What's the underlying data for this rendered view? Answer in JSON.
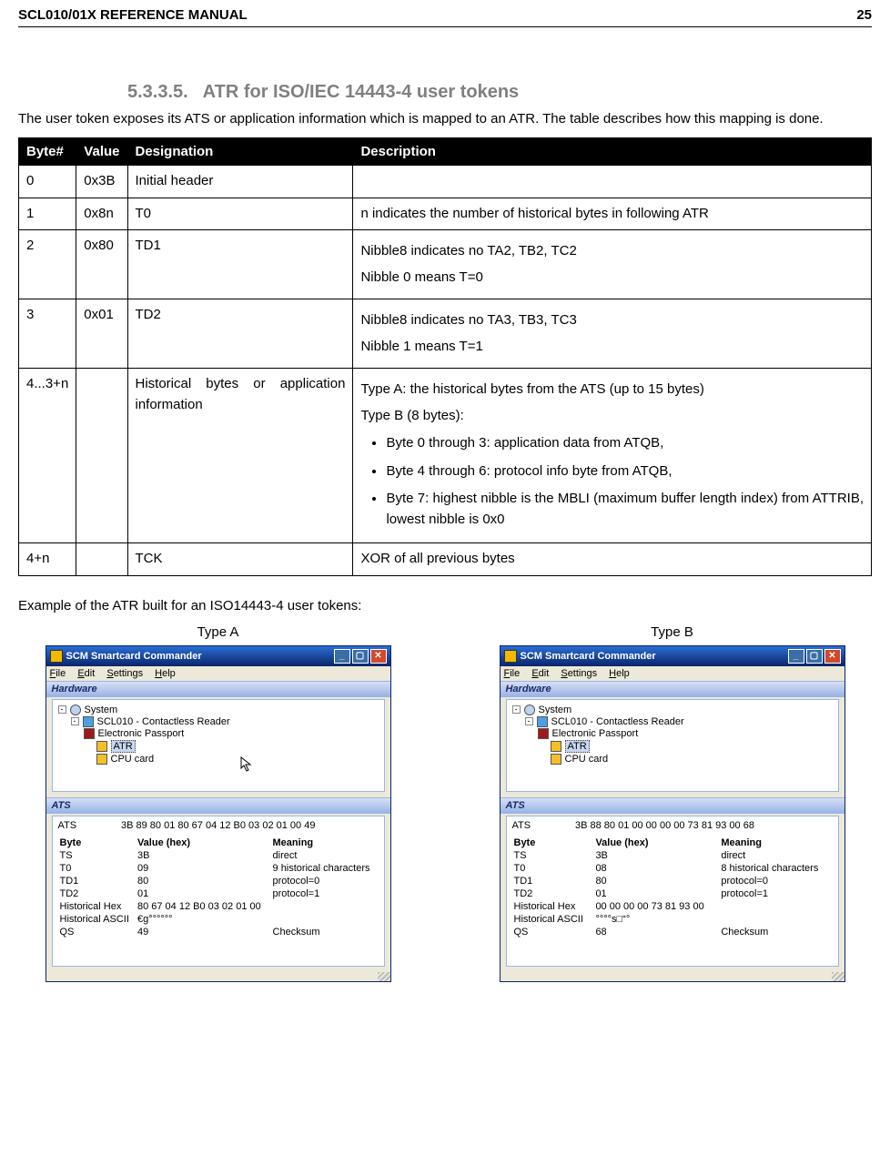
{
  "header": {
    "title": "SCL010/01X REFERENCE MANUAL",
    "page": "25"
  },
  "section": {
    "number": "5.3.3.5.",
    "title": "ATR for ISO/IEC 14443-4 user tokens",
    "intro": "The user token exposes its ATS or application information which is mapped to an ATR. The table describes how this mapping is done."
  },
  "table": {
    "headers": [
      "Byte#",
      "Value",
      "Designation",
      "Description"
    ],
    "rows": [
      {
        "byte": "0",
        "value": "0x3B",
        "designation": "Initial header",
        "desc": ""
      },
      {
        "byte": "1",
        "value": "0x8n",
        "designation": "T0",
        "desc": "n indicates the number of historical bytes in following ATR"
      },
      {
        "byte": "2",
        "value": "0x80",
        "designation": "TD1",
        "desc_line1": "Nibble8 indicates no TA2, TB2, TC2",
        "desc_line2": "Nibble 0 means T=0"
      },
      {
        "byte": "3",
        "value": "0x01",
        "designation": "TD2",
        "desc_line1": "Nibble8 indicates no TA3, TB3, TC3",
        "desc_line2": "Nibble 1 means T=1"
      },
      {
        "byte": "4...3+n",
        "value": "",
        "designation": "Historical bytes or application information",
        "desc_typea": "Type A: the historical bytes from the ATS (up to 15 bytes)",
        "desc_typeb": "Type B (8 bytes):",
        "bullets": [
          "Byte 0 through 3: application data from ATQB,",
          "Byte 4 through 6: protocol info byte from ATQB,",
          "Byte 7: highest nibble is the MBLI (maximum buffer length index) from ATTRIB, lowest nibble is 0x0"
        ]
      },
      {
        "byte": "4+n",
        "value": "",
        "designation": "TCK",
        "desc": "XOR of all previous bytes"
      }
    ]
  },
  "example": {
    "caption": "Example of the ATR built for an ISO14443-4 user tokens:",
    "typeA_label": "Type A",
    "typeB_label": "Type B"
  },
  "window": {
    "title": "SCM Smartcard Commander",
    "menus": [
      "File",
      "Edit",
      "Settings",
      "Help"
    ],
    "hw_label": "Hardware",
    "ats_label": "ATS",
    "tree": {
      "system": "System",
      "reader": "SCL010 - Contactless Reader",
      "passport": "Electronic Passport",
      "atr": "ATR",
      "cpu": "CPU card"
    },
    "cols": {
      "byte": "Byte",
      "value": "Value (hex)",
      "meaning": "Meaning"
    },
    "typeA": {
      "ats": "3B 89 80 01 80 67 04 12 B0 03 02 01 00 49",
      "rows": [
        [
          "TS",
          "3B",
          "direct"
        ],
        [
          "T0",
          "09",
          "9 historical characters"
        ],
        [
          "TD1",
          "80",
          "protocol=0"
        ],
        [
          "TD2",
          "01",
          "protocol=1"
        ],
        [
          "Historical Hex",
          "80 67 04 12 B0 03 02 01 00",
          ""
        ],
        [
          "Historical ASCII",
          "€g°°°°°°",
          ""
        ],
        [
          "QS",
          "49",
          "Checksum"
        ]
      ]
    },
    "typeB": {
      "ats": "3B 88 80 01 00 00 00 00 73 81 93 00 68",
      "rows": [
        [
          "TS",
          "3B",
          "direct"
        ],
        [
          "T0",
          "08",
          "8 historical characters"
        ],
        [
          "TD1",
          "80",
          "protocol=0"
        ],
        [
          "TD2",
          "01",
          "protocol=1"
        ],
        [
          "Historical Hex",
          "00 00 00 00 73 81 93 00",
          ""
        ],
        [
          "Historical ASCII",
          "°°°°s□“°",
          ""
        ],
        [
          "QS",
          "68",
          "Checksum"
        ]
      ]
    }
  }
}
